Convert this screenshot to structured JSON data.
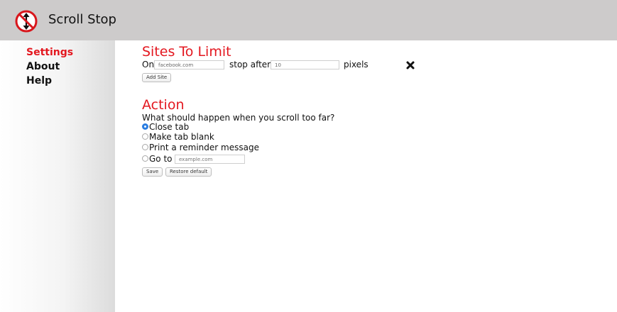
{
  "header": {
    "title": "Scroll Stop",
    "logo_icon": "scroll-stop-logo-icon"
  },
  "sidebar": {
    "items": [
      {
        "label": "Settings",
        "active": true
      },
      {
        "label": "About",
        "active": false
      },
      {
        "label": "Help",
        "active": false
      }
    ]
  },
  "sites": {
    "title": "Sites To Limit",
    "rows": [
      {
        "on_label": "On",
        "site_value": "facebook.com",
        "stop_after_label": "stop after",
        "pixels_value": "10",
        "pixels_label": "pixels",
        "remove_icon": "close-x-icon"
      }
    ],
    "add_site_label": "Add Site"
  },
  "action": {
    "title": "Action",
    "question": "What should happen when you scroll too far?",
    "options": [
      {
        "label": "Close tab",
        "checked": true
      },
      {
        "label": "Make tab blank",
        "checked": false
      },
      {
        "label": "Print a reminder message",
        "checked": false
      },
      {
        "label": "Go to",
        "checked": false
      }
    ],
    "goto_placeholder": "example.com",
    "save_label": "Save",
    "restore_label": "Restore default"
  },
  "colors": {
    "accent": "#e3171f",
    "header_bg": "#cdcbcb",
    "radio_selected": "#2a7de1"
  }
}
